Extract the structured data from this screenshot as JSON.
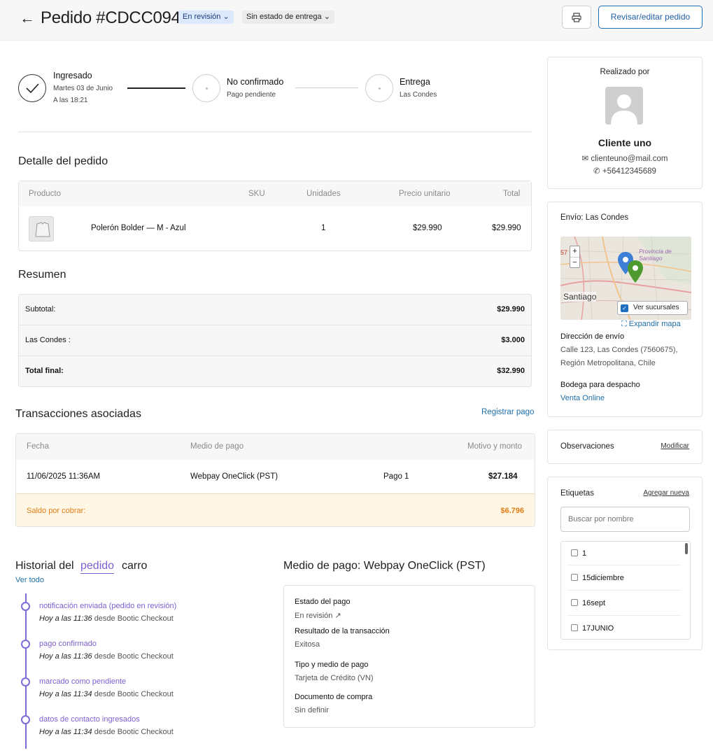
{
  "header": {
    "title": "Pedido #CDCC094",
    "status_badge": "En revisión",
    "delivery_badge": "Sin estado de entrega",
    "edit_button": "Revisar/editar pedido"
  },
  "steps": [
    {
      "title": "Ingresado",
      "line1": "Martes 03 de Junio",
      "line2": "A las 18:21"
    },
    {
      "title": "No confirmado",
      "line1": "Pago pendiente"
    },
    {
      "title": "Entrega",
      "line1": "Las Condes"
    }
  ],
  "detail": {
    "heading": "Detalle del pedido",
    "columns": [
      "Producto",
      "SKU",
      "Unidades",
      "Precio unitario",
      "Total"
    ],
    "rows": [
      {
        "product": "Polerón Bolder — M - Azul",
        "sku": "",
        "units": "1",
        "unit_price": "$29.990",
        "total": "$29.990"
      }
    ]
  },
  "summary": {
    "heading": "Resumen",
    "rows": [
      {
        "label": "Subtotal:",
        "value": "$29.990"
      },
      {
        "label": "Las Condes :",
        "value": "$3.000"
      },
      {
        "label": "Total final:",
        "value": "$32.990"
      }
    ]
  },
  "transactions": {
    "heading": "Transacciones asociadas",
    "register_link": "Registrar pago",
    "columns": [
      "Fecha",
      "Medio de pago",
      "Motivo y monto"
    ],
    "rows": [
      {
        "date": "11/06/2025 11:36AM",
        "method": "Webpay OneClick (PST)",
        "reason": "Pago 1",
        "amount": "$27.184"
      }
    ],
    "balance_label": "Saldo por cobrar:",
    "balance_value": "$6.796"
  },
  "history": {
    "heading": "Historial del",
    "tab_order": "pedido",
    "tab_cart": "carro",
    "view_all": "Ver todo",
    "items": [
      {
        "title": "notificación enviada (pedido en revisión)",
        "when": "Hoy a las 11:36",
        "source": "desde Bootic Checkout"
      },
      {
        "title": "pago confirmado",
        "when": "Hoy a las 11:36",
        "source": "desde Bootic Checkout"
      },
      {
        "title": "marcado como pendiente",
        "when": "Hoy a las 11:34",
        "source": "desde Bootic Checkout"
      },
      {
        "title": "datos de contacto ingresados",
        "when": "Hoy a las 11:34",
        "source": "desde Bootic Checkout"
      }
    ]
  },
  "payment": {
    "heading": "Medio de pago: Webpay OneClick (PST)",
    "fields": [
      {
        "label": "Estado del pago",
        "value": "En revisión"
      },
      {
        "label": "Resultado de la transacción",
        "value": "Exitosa"
      },
      {
        "label": "Tipo y medio de pago",
        "value": "Tarjeta de Crédito (VN)"
      },
      {
        "label": "Documento de compra",
        "value": "Sin definir"
      }
    ]
  },
  "customer": {
    "heading": "Realizado por",
    "name": "Cliente uno",
    "email": "clienteuno@mail.com",
    "phone": "+56412345689"
  },
  "shipping": {
    "heading": "Envío: Las Condes",
    "map_label_city": "Santiago",
    "map_label_province": "Provincia de Santiago",
    "map_label_num": "57",
    "show_branches": "Ver sucursales",
    "expand_map": "Expandir mapa",
    "address_label": "Dirección de envío",
    "address_line1": "Calle 123, Las Condes (7560675),",
    "address_line2": "Región Metropolitana, Chile",
    "warehouse_label": "Bodega para despacho",
    "warehouse_value": "Venta Online"
  },
  "observations": {
    "label": "Observaciones",
    "action": "Modificar"
  },
  "tags": {
    "label": "Etiquetas",
    "action": "Agregar nueva",
    "search_placeholder": "Buscar por nombre",
    "items": [
      "1",
      "15diciembre",
      "16sept",
      "17JUNIO"
    ]
  },
  "colors": {
    "accent": "#1f6fbf",
    "history": "#7d5fd0",
    "warning_bg": "#fff6e6",
    "warning_text": "#e27d12"
  }
}
